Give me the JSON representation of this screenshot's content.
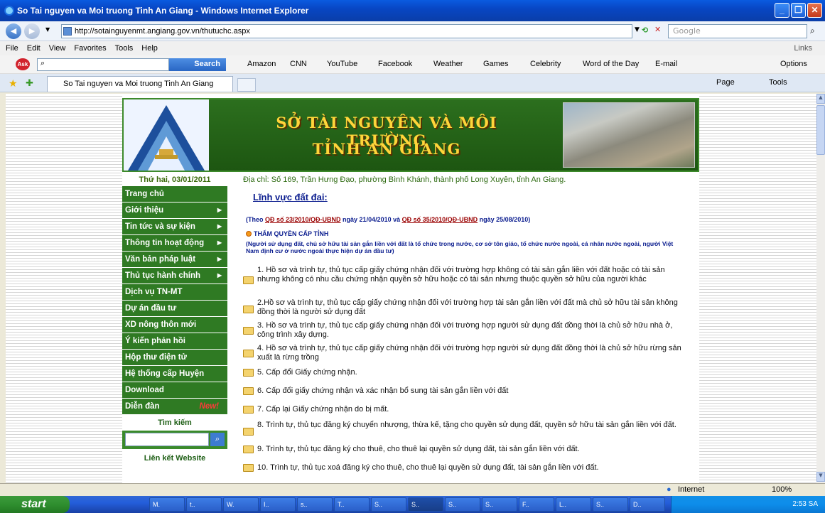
{
  "window": {
    "title": "So Tai nguyen va Moi truong Tinh An Giang - Windows Internet Explorer"
  },
  "address_bar": {
    "url": "http://sotainguyenmt.angiang.gov.vn/thutuchc.aspx",
    "search_placeholder": "Google"
  },
  "menu": [
    "File",
    "Edit",
    "View",
    "Favorites",
    "Tools",
    "Help"
  ],
  "menu_right": "Links",
  "ask_toolbar": {
    "search_button": "Search",
    "links": [
      "Amazon",
      "CNN",
      "YouTube",
      "Facebook",
      "Weather",
      "Games",
      "Celebrity",
      "Word of the Day",
      "E-mail"
    ],
    "options": "Options"
  },
  "tab": {
    "label": "So Tai nguyen va Moi truong Tinh An Giang"
  },
  "tab_tools": {
    "page": "Page",
    "tools": "Tools"
  },
  "banner": {
    "title_line1": "SỞ TÀI NGUYÊN VÀ MÔI TRƯỜNG",
    "title_line2": "TỈNH AN GIANG"
  },
  "date": "Thứ hai, 03/01/2011",
  "address": "Địa chỉ: Số 169, Trần Hưng Đạo, phường Bình Khánh, thành phố Long Xuyên, tỉnh An Giang.",
  "nav": [
    {
      "label": "Trang chủ"
    },
    {
      "label": "Giới thiệu"
    },
    {
      "label": "Tin tức và sự kiện"
    },
    {
      "label": "Thông tin hoạt động"
    },
    {
      "label": "Văn bản pháp luật"
    },
    {
      "label": "Thủ tục hành chính"
    },
    {
      "label": "Dịch vụ TN-MT"
    },
    {
      "label": "Dự án đầu tư"
    },
    {
      "label": "XD nông thôn mới"
    },
    {
      "label": "Ý kiến phản hồi"
    },
    {
      "label": "Hộp thư điện tử"
    },
    {
      "label": "Hệ thống cấp Huyện"
    },
    {
      "label": "Download"
    },
    {
      "label": "Diễn đàn",
      "tag": "New!"
    }
  ],
  "search": {
    "heading": "Tìm kiếm"
  },
  "links_heading": "Liên kết Website",
  "content": {
    "section_title": "Lĩnh vực đất đai:",
    "decision_prefix": "(Theo ",
    "decision_link1": "QĐ số 23/2010/QĐ-UBND",
    "decision_mid": " ngày 21/04/2010 và ",
    "decision_link2": "QĐ số 35/2010/QĐ-UBND",
    "decision_suffix": " ngày 25/08/2010)",
    "authority": "THẨM QUYỀN CẤP TỈNH",
    "authority_note": "(Người sử dụng đất, chủ sở hữu tài sản gắn liền với đất là tổ chức trong nước, cơ sở tôn giáo, tổ chức nước ngoài, cá nhân nước ngoài, người Việt Nam định cư ở nước ngoài thực hiện dự án đầu tư)",
    "procedures": [
      "1. Hồ sơ và trình tự, thủ tục cấp giấy chứng nhận đối với trường hợp không có tài sản gắn liền với đất hoặc có tài sản nhưng không có nhu cầu chứng nhận quyền sở hữu hoặc có tài sản nhưng thuộc quyền sở hữu của người khác",
      "2.Hồ sơ và trình tự, thủ tục cấp giấy chứng nhận đối với trường hợp tài sản gắn liền với đất mà chủ sở hữu tài sản không đồng thời là người sử dụng đất",
      "3. Hồ sơ và trình tự, thủ tục cấp giấy chứng nhận đối với trường hợp người sử dụng đất đồng thời là chủ sở hữu nhà ở, công trình xây dựng.",
      "4. Hồ sơ và trình tự, thủ tục cấp giấy chứng nhận đối với trường hợp người sử dụng đất đồng thời là chủ sở hữu rừng sản xuất là rừng trồng",
      "5. Cấp đổi Giấy chứng nhận.",
      "6. Cấp đổi giấy chứng nhận và xác nhận bổ sung tài sản gắn liền với đất",
      "7. Cấp lại Giấy chứng nhận do bị mất.",
      "8. Trình tự, thủ tục đăng ký chuyển nhượng, thừa kế, tặng cho quyền sử dụng đất, quyền sở hữu tài sản gắn liền với đất.",
      "9. Trình tự, thủ tục đăng ký cho thuê, cho thuê lại quyền sử dụng đất, tài sản gắn liền với đất.",
      "10. Trình tự, thủ tục xoá đăng ký cho thuê, cho thuê lại quyền sử dụng đất, tài sản gắn liền với đất."
    ]
  },
  "status": {
    "zone": "Internet",
    "zoom": "100%"
  },
  "taskbar": {
    "start": "start",
    "buttons": [
      "M.",
      "t..",
      "W.",
      "I..",
      "s..",
      "T..",
      "S..",
      "S..",
      "S..",
      "S..",
      "F..",
      "L..",
      "S..",
      "D.."
    ],
    "clock": "2:53 SA"
  }
}
